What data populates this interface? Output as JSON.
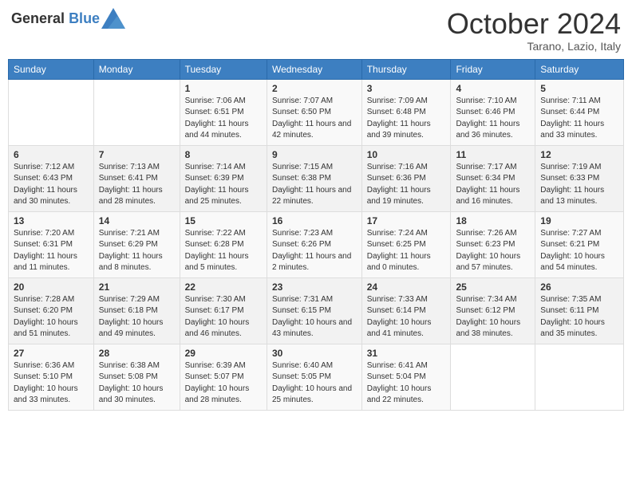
{
  "header": {
    "logo_line1": "General",
    "logo_line2": "Blue",
    "month_title": "October 2024",
    "location": "Tarano, Lazio, Italy"
  },
  "weekdays": [
    "Sunday",
    "Monday",
    "Tuesday",
    "Wednesday",
    "Thursday",
    "Friday",
    "Saturday"
  ],
  "weeks": [
    [
      {
        "day": "",
        "sunrise": "",
        "sunset": "",
        "daylight": ""
      },
      {
        "day": "",
        "sunrise": "",
        "sunset": "",
        "daylight": ""
      },
      {
        "day": "1",
        "sunrise": "Sunrise: 7:06 AM",
        "sunset": "Sunset: 6:51 PM",
        "daylight": "Daylight: 11 hours and 44 minutes."
      },
      {
        "day": "2",
        "sunrise": "Sunrise: 7:07 AM",
        "sunset": "Sunset: 6:50 PM",
        "daylight": "Daylight: 11 hours and 42 minutes."
      },
      {
        "day": "3",
        "sunrise": "Sunrise: 7:09 AM",
        "sunset": "Sunset: 6:48 PM",
        "daylight": "Daylight: 11 hours and 39 minutes."
      },
      {
        "day": "4",
        "sunrise": "Sunrise: 7:10 AM",
        "sunset": "Sunset: 6:46 PM",
        "daylight": "Daylight: 11 hours and 36 minutes."
      },
      {
        "day": "5",
        "sunrise": "Sunrise: 7:11 AM",
        "sunset": "Sunset: 6:44 PM",
        "daylight": "Daylight: 11 hours and 33 minutes."
      }
    ],
    [
      {
        "day": "6",
        "sunrise": "Sunrise: 7:12 AM",
        "sunset": "Sunset: 6:43 PM",
        "daylight": "Daylight: 11 hours and 30 minutes."
      },
      {
        "day": "7",
        "sunrise": "Sunrise: 7:13 AM",
        "sunset": "Sunset: 6:41 PM",
        "daylight": "Daylight: 11 hours and 28 minutes."
      },
      {
        "day": "8",
        "sunrise": "Sunrise: 7:14 AM",
        "sunset": "Sunset: 6:39 PM",
        "daylight": "Daylight: 11 hours and 25 minutes."
      },
      {
        "day": "9",
        "sunrise": "Sunrise: 7:15 AM",
        "sunset": "Sunset: 6:38 PM",
        "daylight": "Daylight: 11 hours and 22 minutes."
      },
      {
        "day": "10",
        "sunrise": "Sunrise: 7:16 AM",
        "sunset": "Sunset: 6:36 PM",
        "daylight": "Daylight: 11 hours and 19 minutes."
      },
      {
        "day": "11",
        "sunrise": "Sunrise: 7:17 AM",
        "sunset": "Sunset: 6:34 PM",
        "daylight": "Daylight: 11 hours and 16 minutes."
      },
      {
        "day": "12",
        "sunrise": "Sunrise: 7:19 AM",
        "sunset": "Sunset: 6:33 PM",
        "daylight": "Daylight: 11 hours and 13 minutes."
      }
    ],
    [
      {
        "day": "13",
        "sunrise": "Sunrise: 7:20 AM",
        "sunset": "Sunset: 6:31 PM",
        "daylight": "Daylight: 11 hours and 11 minutes."
      },
      {
        "day": "14",
        "sunrise": "Sunrise: 7:21 AM",
        "sunset": "Sunset: 6:29 PM",
        "daylight": "Daylight: 11 hours and 8 minutes."
      },
      {
        "day": "15",
        "sunrise": "Sunrise: 7:22 AM",
        "sunset": "Sunset: 6:28 PM",
        "daylight": "Daylight: 11 hours and 5 minutes."
      },
      {
        "day": "16",
        "sunrise": "Sunrise: 7:23 AM",
        "sunset": "Sunset: 6:26 PM",
        "daylight": "Daylight: 11 hours and 2 minutes."
      },
      {
        "day": "17",
        "sunrise": "Sunrise: 7:24 AM",
        "sunset": "Sunset: 6:25 PM",
        "daylight": "Daylight: 11 hours and 0 minutes."
      },
      {
        "day": "18",
        "sunrise": "Sunrise: 7:26 AM",
        "sunset": "Sunset: 6:23 PM",
        "daylight": "Daylight: 10 hours and 57 minutes."
      },
      {
        "day": "19",
        "sunrise": "Sunrise: 7:27 AM",
        "sunset": "Sunset: 6:21 PM",
        "daylight": "Daylight: 10 hours and 54 minutes."
      }
    ],
    [
      {
        "day": "20",
        "sunrise": "Sunrise: 7:28 AM",
        "sunset": "Sunset: 6:20 PM",
        "daylight": "Daylight: 10 hours and 51 minutes."
      },
      {
        "day": "21",
        "sunrise": "Sunrise: 7:29 AM",
        "sunset": "Sunset: 6:18 PM",
        "daylight": "Daylight: 10 hours and 49 minutes."
      },
      {
        "day": "22",
        "sunrise": "Sunrise: 7:30 AM",
        "sunset": "Sunset: 6:17 PM",
        "daylight": "Daylight: 10 hours and 46 minutes."
      },
      {
        "day": "23",
        "sunrise": "Sunrise: 7:31 AM",
        "sunset": "Sunset: 6:15 PM",
        "daylight": "Daylight: 10 hours and 43 minutes."
      },
      {
        "day": "24",
        "sunrise": "Sunrise: 7:33 AM",
        "sunset": "Sunset: 6:14 PM",
        "daylight": "Daylight: 10 hours and 41 minutes."
      },
      {
        "day": "25",
        "sunrise": "Sunrise: 7:34 AM",
        "sunset": "Sunset: 6:12 PM",
        "daylight": "Daylight: 10 hours and 38 minutes."
      },
      {
        "day": "26",
        "sunrise": "Sunrise: 7:35 AM",
        "sunset": "Sunset: 6:11 PM",
        "daylight": "Daylight: 10 hours and 35 minutes."
      }
    ],
    [
      {
        "day": "27",
        "sunrise": "Sunrise: 6:36 AM",
        "sunset": "Sunset: 5:10 PM",
        "daylight": "Daylight: 10 hours and 33 minutes."
      },
      {
        "day": "28",
        "sunrise": "Sunrise: 6:38 AM",
        "sunset": "Sunset: 5:08 PM",
        "daylight": "Daylight: 10 hours and 30 minutes."
      },
      {
        "day": "29",
        "sunrise": "Sunrise: 6:39 AM",
        "sunset": "Sunset: 5:07 PM",
        "daylight": "Daylight: 10 hours and 28 minutes."
      },
      {
        "day": "30",
        "sunrise": "Sunrise: 6:40 AM",
        "sunset": "Sunset: 5:05 PM",
        "daylight": "Daylight: 10 hours and 25 minutes."
      },
      {
        "day": "31",
        "sunrise": "Sunrise: 6:41 AM",
        "sunset": "Sunset: 5:04 PM",
        "daylight": "Daylight: 10 hours and 22 minutes."
      },
      {
        "day": "",
        "sunrise": "",
        "sunset": "",
        "daylight": ""
      },
      {
        "day": "",
        "sunrise": "",
        "sunset": "",
        "daylight": ""
      }
    ]
  ]
}
